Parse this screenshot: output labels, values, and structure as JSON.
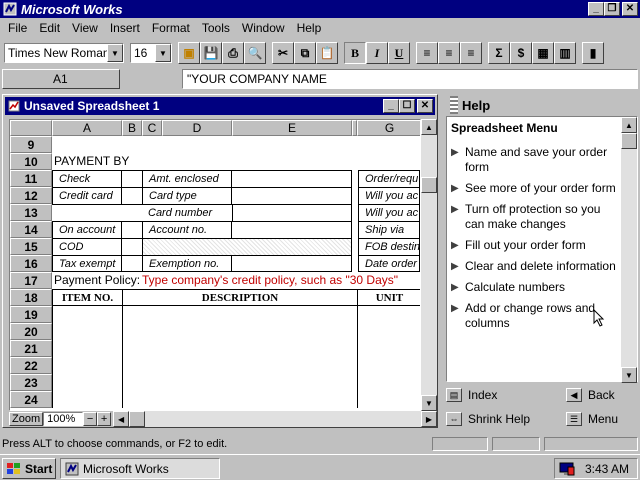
{
  "app": {
    "title": "Microsoft Works"
  },
  "menubar": [
    "File",
    "Edit",
    "View",
    "Insert",
    "Format",
    "Tools",
    "Window",
    "Help"
  ],
  "toolbar": {
    "font_name": "Times New Roman",
    "font_size": "16"
  },
  "formula_bar": {
    "cell_ref": "A1",
    "content": "\"YOUR COMPANY NAME"
  },
  "document": {
    "title": "Unsaved Spreadsheet 1",
    "columns": [
      "A",
      "B",
      "C",
      "D",
      "E",
      "G"
    ],
    "rows": [
      {
        "num": "9",
        "cells": []
      },
      {
        "num": "10",
        "cells": [
          "PAYMENT BY"
        ]
      },
      {
        "num": "11",
        "cells": [
          "Check",
          "Amt. enclosed",
          "Order/requ"
        ]
      },
      {
        "num": "12",
        "cells": [
          "Credit card",
          "Card type",
          "Will you ac"
        ]
      },
      {
        "num": "13",
        "cells": [
          "Card number",
          "Will you ac"
        ]
      },
      {
        "num": "14",
        "cells": [
          "On account",
          "Account no.",
          "Ship via"
        ]
      },
      {
        "num": "15",
        "cells": [
          "COD",
          "FOB destin"
        ]
      },
      {
        "num": "16",
        "cells": [
          "Tax exempt",
          "Exemption no.",
          "Date order"
        ]
      },
      {
        "num": "17",
        "cells": [
          "Payment Policy:",
          "Type company's credit policy, such as \"30 Days\""
        ]
      },
      {
        "num": "18",
        "cells": [
          "ITEM NO.",
          "DESCRIPTION",
          "UNIT"
        ]
      },
      {
        "num": "19",
        "cells": []
      },
      {
        "num": "20",
        "cells": []
      },
      {
        "num": "21",
        "cells": []
      },
      {
        "num": "22",
        "cells": []
      },
      {
        "num": "23",
        "cells": []
      },
      {
        "num": "24",
        "cells": []
      }
    ],
    "zoom_label": "Zoom",
    "zoom_value": "100%",
    "zoom_minus": "−",
    "zoom_plus": "+"
  },
  "help": {
    "title": "Help",
    "heading": "Spreadsheet Menu",
    "items": [
      "Name and save your order form",
      "See more of your order form",
      "Turn off protection so you can make changes",
      "Fill out your order form",
      "Clear and delete information",
      "Calculate numbers",
      "Add or change rows and columns"
    ],
    "nav": {
      "index": "Index",
      "back": "Back",
      "shrink": "Shrink Help",
      "menu": "Menu"
    }
  },
  "status_bar": {
    "message": "Press ALT to choose commands, or F2 to edit."
  },
  "taskbar": {
    "start": "Start",
    "task": "Microsoft Works",
    "clock": "3:43 AM"
  },
  "colors": {
    "title_bar": "#000080",
    "face": "#c0c0c0",
    "policy_text": "#c00000"
  }
}
